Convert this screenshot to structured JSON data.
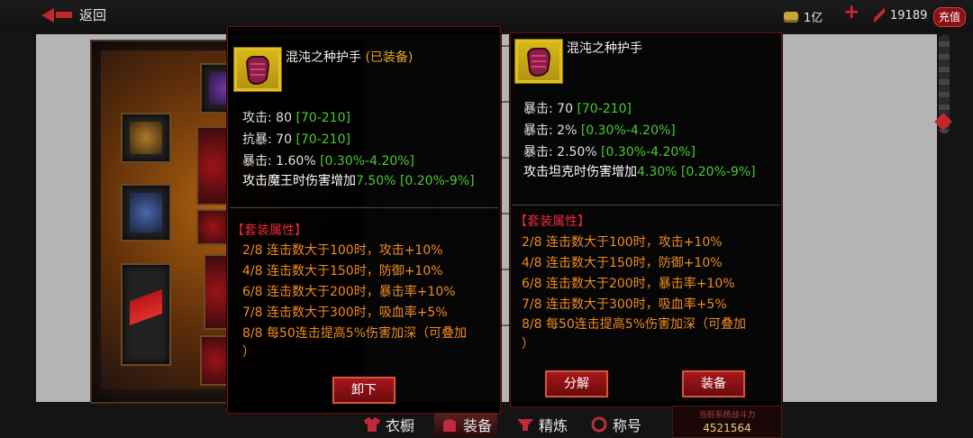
{
  "topbar": {
    "back_label": "返回",
    "gold": "1亿",
    "power_stat": "19189",
    "recharge_label": "充值"
  },
  "popup_left": {
    "item_name": "混沌之种护手",
    "equipped_tag": "(已装备)",
    "stats": [
      {
        "label": "攻击: 80 ",
        "range": "[70-210]"
      },
      {
        "label": "抗暴: 70 ",
        "range": "[70-210]"
      },
      {
        "label": "暴击: 1.60% ",
        "range": "[0.30%-4.20%]"
      },
      {
        "label": "攻击魔王时伤害增加",
        "value": "7.50% ",
        "range": "[0.20%-9%]"
      }
    ],
    "set_title": "【套装属性】",
    "set_bonuses": [
      "2/8   连击数大于100时，攻击+10%",
      "4/8   连击数大于150时，防御+10%",
      "6/8   连击数大于200时，暴击率+10%",
      "7/8   连击数大于300时，吸血率+5%",
      "8/8   每50连击提高5%伤害加深（可叠加",
      "）"
    ],
    "button_label": "卸下"
  },
  "popup_right": {
    "item_name": "混沌之种护手",
    "stats": [
      {
        "label": "暴击: 70 ",
        "range": "[70-210]"
      },
      {
        "label": "暴击: 2% ",
        "range": "[0.30%-4.20%]"
      },
      {
        "label": "暴击: 2.50% ",
        "range": "[0.30%-4.20%]"
      },
      {
        "label": "攻击坦克时伤害增加",
        "value": "4.30% ",
        "range": "[0.20%-9%]"
      }
    ],
    "set_title": "【套装属性】",
    "set_bonuses": [
      "2/8   连击数大于100时，攻击+10%",
      "4/8   连击数大于150时，防御+10%",
      "6/8   连击数大于200时，暴击率+10%",
      "7/8   连击数大于300时，吸血率+5%",
      "8/8   每50连击提高5%伤害加深（可叠加",
      "）"
    ],
    "decompose_label": "分解",
    "equip_label": "装备"
  },
  "tabs": [
    {
      "label": "衣橱",
      "icon": "wardrobe-icon"
    },
    {
      "label": "装备",
      "icon": "equipment-icon"
    },
    {
      "label": "精炼",
      "icon": "refine-icon"
    },
    {
      "label": "称号",
      "icon": "title-icon"
    }
  ],
  "power": {
    "label": "当前系统战斗力",
    "value": "4521564"
  },
  "colors": {
    "accent_red": "#c0272d",
    "range_green": "#4cc832",
    "set_orange": "#f08a20",
    "equipped_gold": "#e8a820"
  }
}
